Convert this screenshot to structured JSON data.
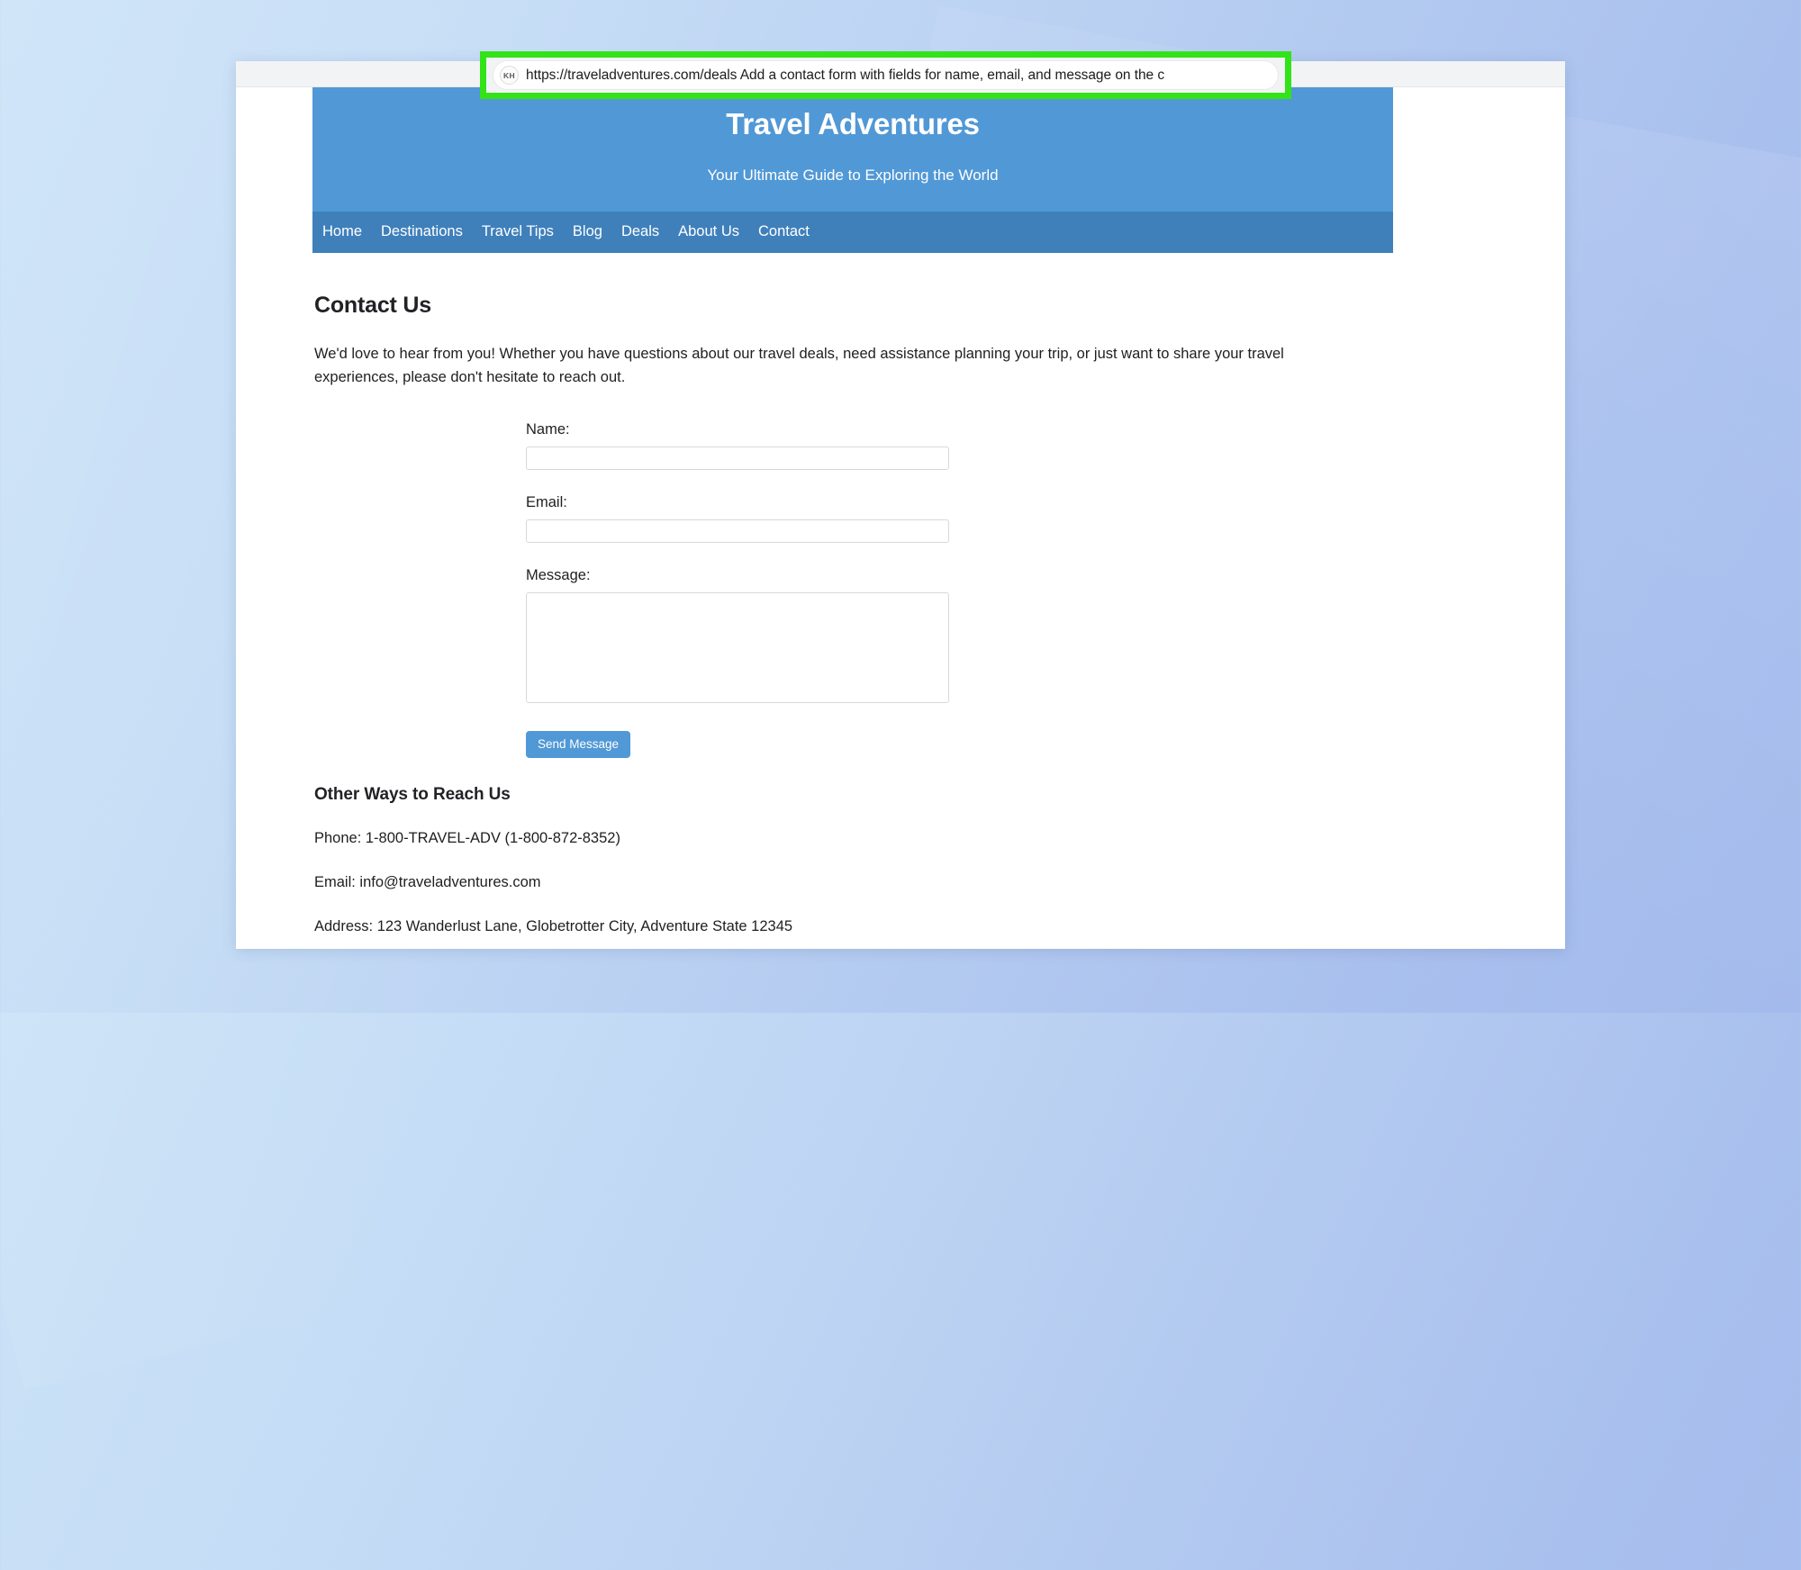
{
  "browser": {
    "url_bar": {
      "profile_initials": "KH",
      "value": "https://traveladventures.com/deals Add a contact form with fields for name, email, and message on the c",
      "placeholder": "Search or enter address"
    },
    "highlight_color": "#32e318"
  },
  "site": {
    "title": "Travel Adventures",
    "tagline": "Your Ultimate Guide to Exploring the World",
    "header_color": "#5198d6",
    "nav_color": "#3f80bb",
    "nav": [
      {
        "label": "Home"
      },
      {
        "label": "Destinations"
      },
      {
        "label": "Travel Tips"
      },
      {
        "label": "Blog"
      },
      {
        "label": "Deals"
      },
      {
        "label": "About Us"
      },
      {
        "label": "Contact"
      }
    ],
    "main": {
      "heading": "Contact Us",
      "intro": "We'd love to hear from you! Whether you have questions about our travel deals, need assistance planning your trip, or just want to share your travel experiences, please don't hesitate to reach out.",
      "form": {
        "name_label": "Name:",
        "name_value": "",
        "email_label": "Email:",
        "email_value": "",
        "message_label": "Message:",
        "message_value": "",
        "submit_label": "Send Message",
        "submit_color": "#5198d6"
      },
      "other_ways": {
        "heading": "Other Ways to Reach Us",
        "phone": "Phone: 1-800-TRAVEL-ADV (1-800-872-8352)",
        "email": "Email: info@traveladventures.com",
        "address": "Address: 123 Wanderlust Lane, Globetrotter City, Adventure State 12345"
      }
    }
  }
}
